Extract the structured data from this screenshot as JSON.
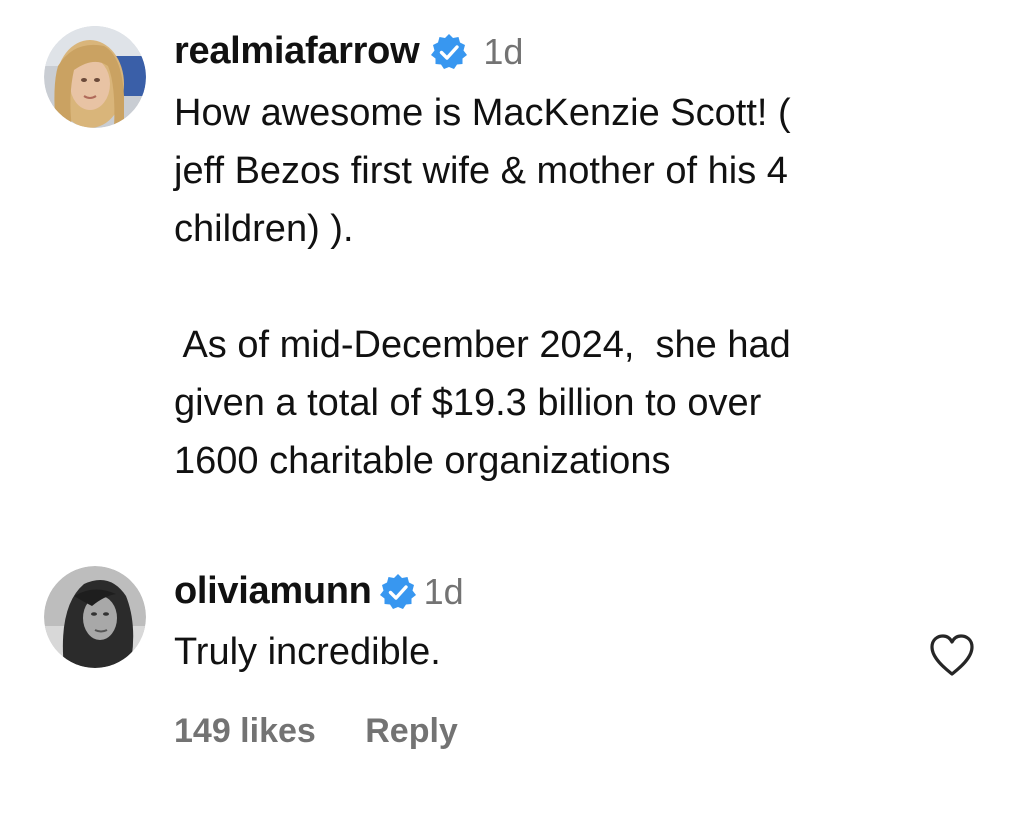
{
  "comments": [
    {
      "username": "realmiafarrow",
      "verified": true,
      "time": "1d",
      "avatar_icon": "user-avatar-blonde-woman",
      "text": "How awesome is MacKenzie Scott! (\njeff Bezos first wife & mother of his 4\nchildren) ).\n\n As of mid-December 2024,  she had\ngiven a total of $19.3 billion to over\n1600 charitable organizations"
    },
    {
      "username": "oliviamunn",
      "verified": true,
      "time": "1d",
      "avatar_icon": "user-avatar-dark-hair-woman",
      "text": "Truly incredible.",
      "likes": "149 likes",
      "reply_label": "Reply",
      "like_icon": "heart-outline-icon"
    }
  ],
  "colors": {
    "text": "#111111",
    "secondary": "#737373",
    "verified_badge": "#3897f0",
    "background": "#ffffff"
  }
}
